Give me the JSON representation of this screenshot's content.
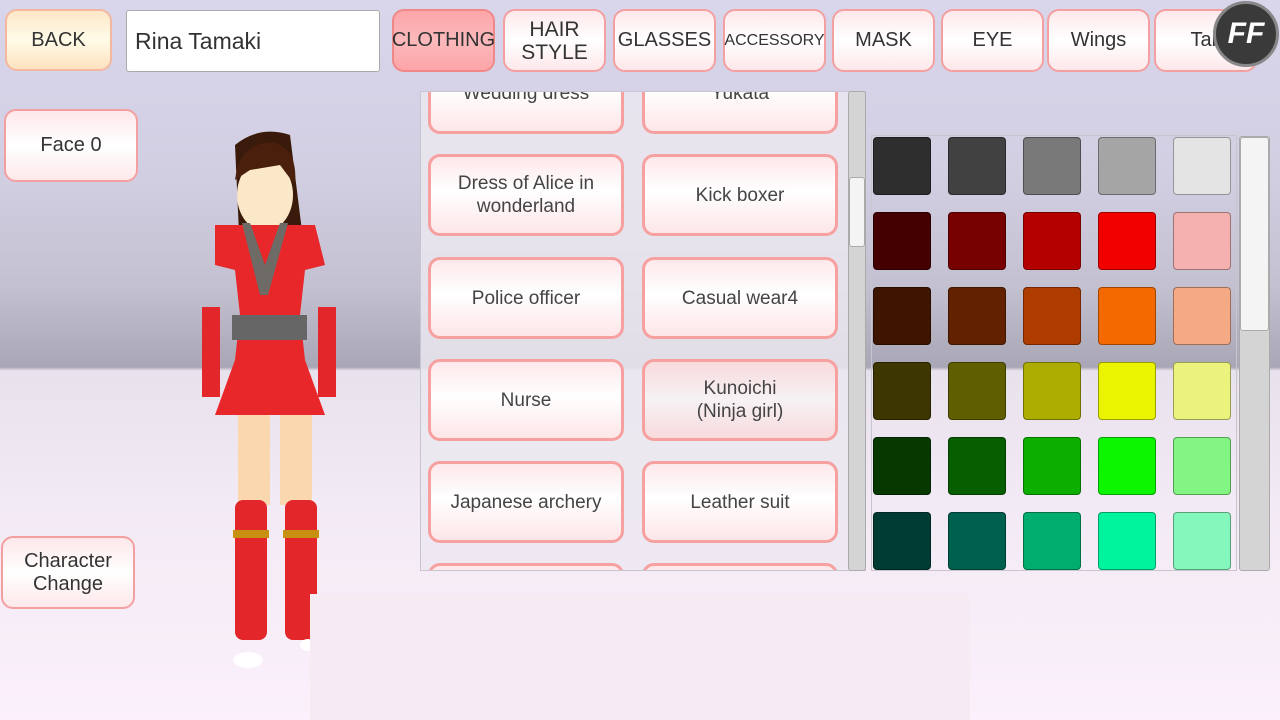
{
  "header": {
    "back_label": "BACK",
    "name_value": "Rina Tamaki",
    "tabs": [
      {
        "label": "CLOTHING",
        "active": true
      },
      {
        "label": "HAIR\nSTYLE"
      },
      {
        "label": "GLASSES"
      },
      {
        "label": "ACCESSORY"
      },
      {
        "label": "MASK"
      },
      {
        "label": "EYE"
      },
      {
        "label": "Wings"
      },
      {
        "label": "Tail"
      }
    ],
    "logo": "FF"
  },
  "left": {
    "face_label": "Face 0",
    "character_change_label": "Character\nChange"
  },
  "clothing_list": {
    "items": [
      [
        "Wedding dress",
        "Yukata"
      ],
      [
        "Dress of Alice in\nwonderland",
        "Kick boxer"
      ],
      [
        "Police officer",
        "Casual wear4"
      ],
      [
        "Nurse",
        "Kunoichi\n(Ninja girl)"
      ],
      [
        "Japanese archery",
        "Leather suit"
      ],
      [
        "",
        ""
      ]
    ],
    "selected": "Kunoichi\n(Ninja girl)"
  },
  "palette": [
    [
      "#2e2e2e",
      "#414141",
      "#797979",
      "#a5a5a5",
      "#e4e4e4"
    ],
    [
      "#440000",
      "#770000",
      "#b50000",
      "#f20000",
      "#f5b0b0"
    ],
    [
      "#3d1500",
      "#622200",
      "#ae3c00",
      "#f56a00",
      "#f5a985"
    ],
    [
      "#3d3600",
      "#5f5e00",
      "#adac00",
      "#eaf300",
      "#ebf37e"
    ],
    [
      "#073800",
      "#065e00",
      "#0caf00",
      "#0cf600",
      "#83f582"
    ],
    [
      "#003c33",
      "#006050",
      "#00ad6c",
      "#00f49e",
      "#84f7bc"
    ]
  ],
  "colors": {
    "accent": "#f4a0a0",
    "active_tab": "#fda5a8"
  }
}
